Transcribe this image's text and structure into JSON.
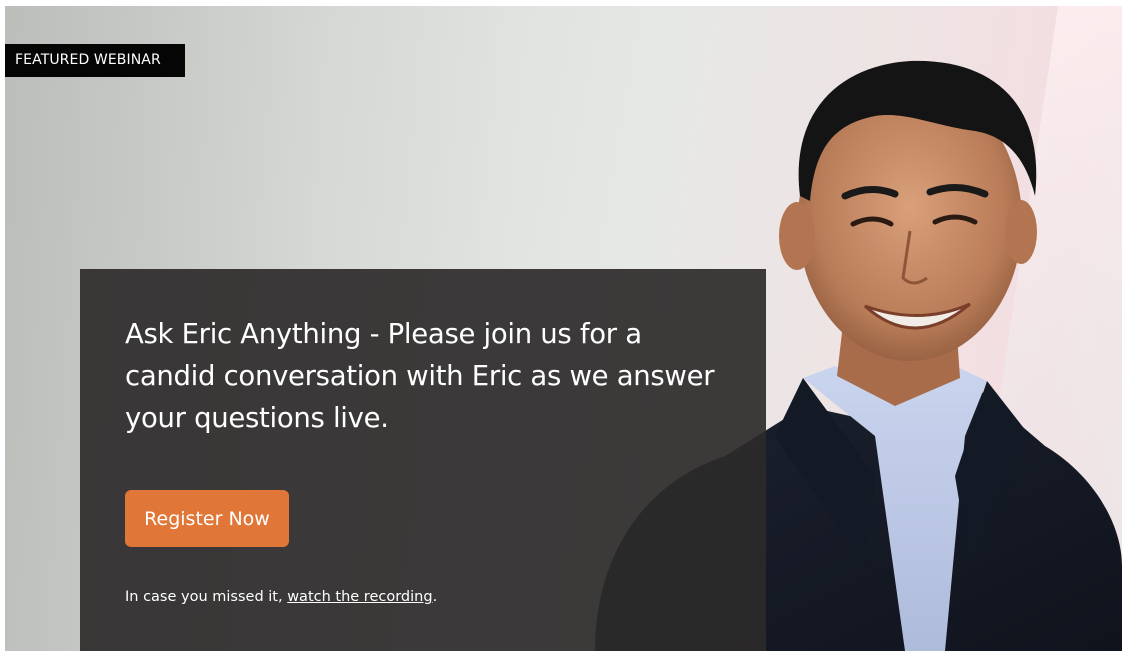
{
  "hero": {
    "badge": "FEATURED WEBINAR",
    "headline": "Ask Eric Anything - Please join us for a candid conversation with Eric as we answer your questions live.",
    "cta_label": "Register Now",
    "missed_prefix": "In case you missed it, ",
    "missed_link": "watch the recording",
    "missed_suffix": "."
  },
  "colors": {
    "badge_bg": "#050505",
    "card_bg": "#2c2a2a",
    "cta_bg": "#e07638"
  },
  "icons": {
    "speaker_photo": "portrait-of-eric"
  }
}
